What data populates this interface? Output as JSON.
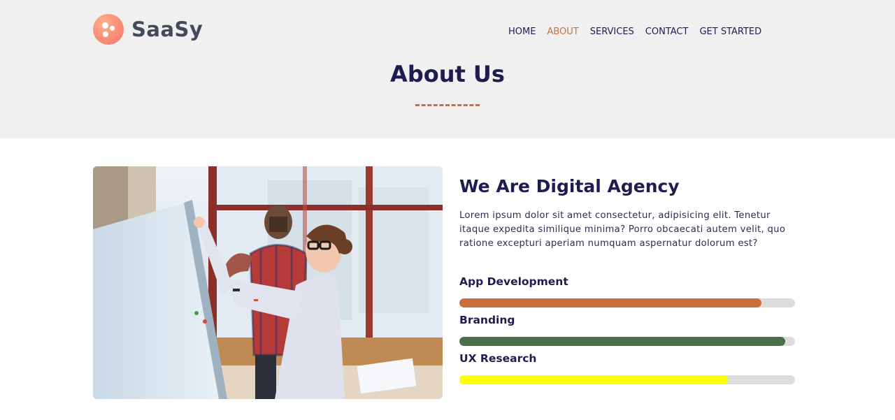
{
  "brand": {
    "name": "SaaSy",
    "icon": "logo-dots-icon",
    "logo_color": "#f98d77"
  },
  "nav": {
    "items": [
      {
        "label": "HOME",
        "active": false
      },
      {
        "label": "ABOUT",
        "active": true
      },
      {
        "label": "SERVICES",
        "active": false
      },
      {
        "label": "CONTACT",
        "active": false
      },
      {
        "label": "GET STARTED",
        "active": false
      }
    ],
    "active_color": "#c9703a"
  },
  "hero": {
    "title": "About Us",
    "divider_color": "#c9703a"
  },
  "about": {
    "image": "team-whiteboard-photo",
    "heading": "We Are Digital Agency",
    "paragraph": "Lorem ipsum dolor sit amet consectetur, adipisicing elit. Tenetur itaque expedita similique minima? Porro obcaecati autem velit, quo ratione excepturi aperiam numquam aspernatur dolorum est?"
  },
  "skills": [
    {
      "label": "App Development",
      "percent": 90,
      "color": "#c9703a"
    },
    {
      "label": "Branding",
      "percent": 97,
      "color": "#4a6e4b"
    },
    {
      "label": "UX Research",
      "percent": 80,
      "color": "#ffff00"
    }
  ]
}
